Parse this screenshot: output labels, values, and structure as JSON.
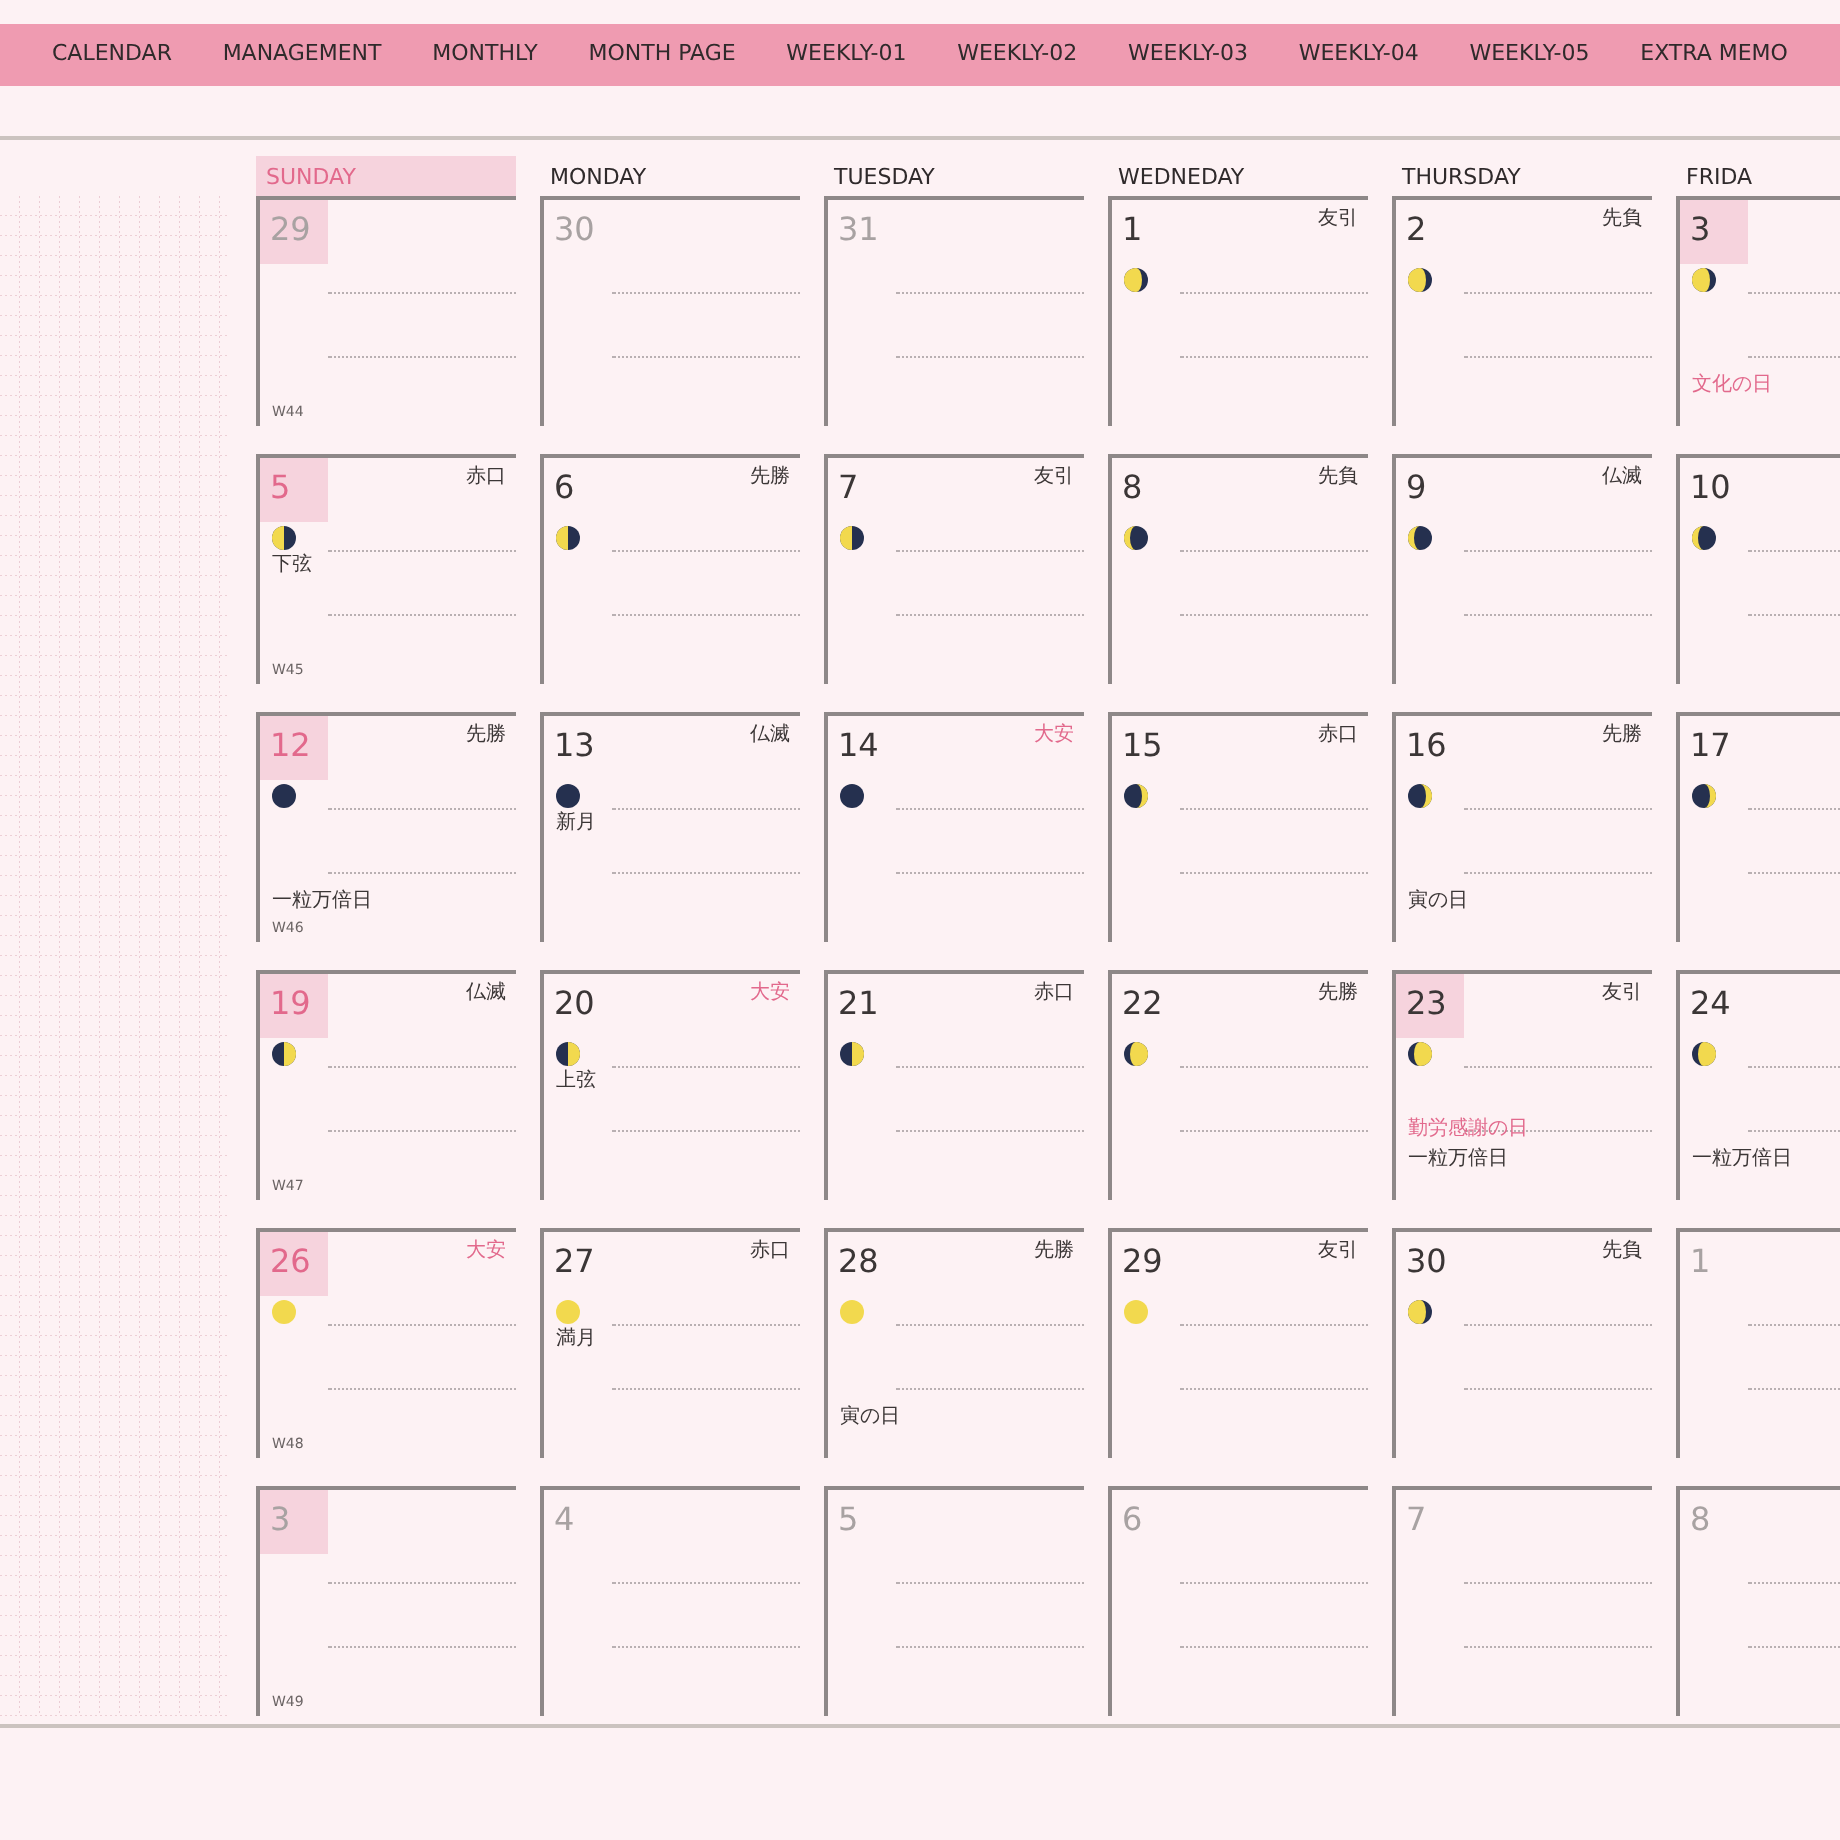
{
  "nav": [
    {
      "label": "CALENDAR"
    },
    {
      "label": "MANAGEMENT"
    },
    {
      "label": "MONTHLY"
    },
    {
      "label": "MONTH PAGE"
    },
    {
      "label": "WEEKLY-01"
    },
    {
      "label": "WEEKLY-02"
    },
    {
      "label": "WEEKLY-03"
    },
    {
      "label": "WEEKLY-04"
    },
    {
      "label": "WEEKLY-05"
    },
    {
      "label": "EXTRA MEMO"
    }
  ],
  "weekdays": [
    {
      "label": "SUNDAY",
      "kind": "sunday"
    },
    {
      "label": "MONDAY",
      "kind": "weekday"
    },
    {
      "label": "TUESDAY",
      "kind": "weekday"
    },
    {
      "label": "WEDNEDAY",
      "kind": "weekday"
    },
    {
      "label": "THURSDAY",
      "kind": "weekday"
    },
    {
      "label": "FRIDA",
      "kind": "weekday"
    }
  ],
  "weeks": [
    {
      "week_label": "W44",
      "days": [
        {
          "date": "29",
          "other_month": true,
          "holiday": true
        },
        {
          "date": "30",
          "other_month": true,
          "holiday": false
        },
        {
          "date": "31",
          "other_month": true,
          "holiday": false
        },
        {
          "date": "1",
          "other_month": false,
          "holiday": false,
          "rokuyo": {
            "text": "友引",
            "lucky": false
          },
          "moon": {
            "kind": "waning_gibbous"
          }
        },
        {
          "date": "2",
          "other_month": false,
          "holiday": false,
          "rokuyo": {
            "text": "先負",
            "lucky": false
          },
          "moon": {
            "kind": "waning_gibbous"
          }
        },
        {
          "date": "3",
          "other_month": false,
          "holiday": true,
          "moon": {
            "kind": "waning_gibbous"
          },
          "notes": [
            {
              "text": "文化の日",
              "kind": "holiday"
            }
          ]
        }
      ]
    },
    {
      "week_label": "W45",
      "days": [
        {
          "date": "5",
          "other_month": false,
          "holiday": true,
          "rokuyo": {
            "text": "赤口",
            "lucky": false
          },
          "moon": {
            "kind": "last_quarter"
          },
          "moon_label": "下弦"
        },
        {
          "date": "6",
          "other_month": false,
          "holiday": false,
          "rokuyo": {
            "text": "先勝",
            "lucky": false
          },
          "moon": {
            "kind": "last_quarter"
          }
        },
        {
          "date": "7",
          "other_month": false,
          "holiday": false,
          "rokuyo": {
            "text": "友引",
            "lucky": false
          },
          "moon": {
            "kind": "last_quarter"
          }
        },
        {
          "date": "8",
          "other_month": false,
          "holiday": false,
          "rokuyo": {
            "text": "先負",
            "lucky": false
          },
          "moon": {
            "kind": "waning_crescent"
          }
        },
        {
          "date": "9",
          "other_month": false,
          "holiday": false,
          "rokuyo": {
            "text": "仏滅",
            "lucky": false
          },
          "moon": {
            "kind": "waning_crescent"
          }
        },
        {
          "date": "10",
          "other_month": false,
          "holiday": false,
          "moon": {
            "kind": "waning_crescent"
          }
        }
      ]
    },
    {
      "week_label": "W46",
      "days": [
        {
          "date": "12",
          "other_month": false,
          "holiday": true,
          "rokuyo": {
            "text": "先勝",
            "lucky": false
          },
          "moon": {
            "kind": "new"
          },
          "notes": [
            {
              "text": "一粒万倍日",
              "kind": "event"
            }
          ]
        },
        {
          "date": "13",
          "other_month": false,
          "holiday": false,
          "rokuyo": {
            "text": "仏滅",
            "lucky": false
          },
          "moon": {
            "kind": "new"
          },
          "moon_label": "新月"
        },
        {
          "date": "14",
          "other_month": false,
          "holiday": false,
          "rokuyo": {
            "text": "大安",
            "lucky": true
          },
          "moon": {
            "kind": "new"
          }
        },
        {
          "date": "15",
          "other_month": false,
          "holiday": false,
          "rokuyo": {
            "text": "赤口",
            "lucky": false
          },
          "moon": {
            "kind": "waxing_crescent"
          }
        },
        {
          "date": "16",
          "other_month": false,
          "holiday": false,
          "rokuyo": {
            "text": "先勝",
            "lucky": false
          },
          "moon": {
            "kind": "waxing_crescent"
          },
          "notes": [
            {
              "text": "寅の日",
              "kind": "event"
            }
          ]
        },
        {
          "date": "17",
          "other_month": false,
          "holiday": false,
          "moon": {
            "kind": "waxing_crescent"
          }
        }
      ]
    },
    {
      "week_label": "W47",
      "days": [
        {
          "date": "19",
          "other_month": false,
          "holiday": true,
          "rokuyo": {
            "text": "仏滅",
            "lucky": false
          },
          "moon": {
            "kind": "first_quarter"
          }
        },
        {
          "date": "20",
          "other_month": false,
          "holiday": false,
          "rokuyo": {
            "text": "大安",
            "lucky": true
          },
          "moon": {
            "kind": "first_quarter"
          },
          "moon_label": "上弦"
        },
        {
          "date": "21",
          "other_month": false,
          "holiday": false,
          "rokuyo": {
            "text": "赤口",
            "lucky": false
          },
          "moon": {
            "kind": "first_quarter"
          }
        },
        {
          "date": "22",
          "other_month": false,
          "holiday": false,
          "rokuyo": {
            "text": "先勝",
            "lucky": false
          },
          "moon": {
            "kind": "waxing_gibbous"
          }
        },
        {
          "date": "23",
          "other_month": false,
          "holiday": true,
          "rokuyo": {
            "text": "友引",
            "lucky": false
          },
          "moon": {
            "kind": "waxing_gibbous"
          },
          "notes": [
            {
              "text": "勤労感謝の日",
              "kind": "holiday"
            },
            {
              "text": "一粒万倍日",
              "kind": "event"
            }
          ]
        },
        {
          "date": "24",
          "other_month": false,
          "holiday": false,
          "moon": {
            "kind": "waxing_gibbous"
          },
          "notes": [
            {
              "text": "一粒万倍日",
              "kind": "event"
            }
          ]
        }
      ]
    },
    {
      "week_label": "W48",
      "days": [
        {
          "date": "26",
          "other_month": false,
          "holiday": true,
          "rokuyo": {
            "text": "大安",
            "lucky": true
          },
          "moon": {
            "kind": "full"
          }
        },
        {
          "date": "27",
          "other_month": false,
          "holiday": false,
          "rokuyo": {
            "text": "赤口",
            "lucky": false
          },
          "moon": {
            "kind": "full"
          },
          "moon_label": "満月"
        },
        {
          "date": "28",
          "other_month": false,
          "holiday": false,
          "rokuyo": {
            "text": "先勝",
            "lucky": false
          },
          "moon": {
            "kind": "full"
          },
          "notes": [
            {
              "text": "寅の日",
              "kind": "event"
            }
          ]
        },
        {
          "date": "29",
          "other_month": false,
          "holiday": false,
          "rokuyo": {
            "text": "友引",
            "lucky": false
          },
          "moon": {
            "kind": "full"
          }
        },
        {
          "date": "30",
          "other_month": false,
          "holiday": false,
          "rokuyo": {
            "text": "先負",
            "lucky": false
          },
          "moon": {
            "kind": "waning_gibbous"
          }
        },
        {
          "date": "1",
          "other_month": true,
          "holiday": false
        }
      ]
    },
    {
      "week_label": "W49",
      "days": [
        {
          "date": "3",
          "other_month": true,
          "holiday": true
        },
        {
          "date": "4",
          "other_month": true,
          "holiday": false
        },
        {
          "date": "5",
          "other_month": true,
          "holiday": false
        },
        {
          "date": "6",
          "other_month": true,
          "holiday": false
        },
        {
          "date": "7",
          "other_month": true,
          "holiday": false
        },
        {
          "date": "8",
          "other_month": true,
          "holiday": false
        }
      ]
    }
  ]
}
